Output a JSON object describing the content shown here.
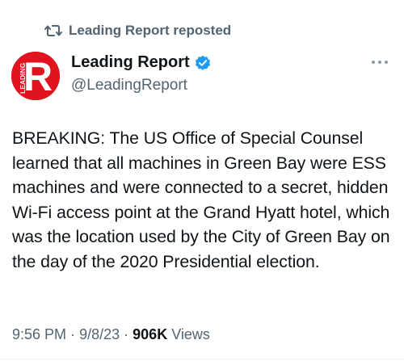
{
  "repost": {
    "icon": "repost-icon",
    "label": "Leading Report reposted"
  },
  "author": {
    "avatar_icon": "leading-report-logo",
    "avatar_letter": "R",
    "avatar_text": "LEADING",
    "name": "Leading Report",
    "verified_icon": "verified-badge-icon",
    "handle": "@LeadingReport",
    "brand_color": "#e0131f",
    "verified_color": "#1d9bf0"
  },
  "post": {
    "more_icon": "more-horizontal-icon",
    "text": "BREAKING: The US Office of Special Counsel learned that all machines in Green Bay were ESS machines and were connected to a secret, hidden Wi-Fi access point at the Grand Hyatt hotel, which was the location used by the City of Green Bay on the day of the 2020 Presidential election.",
    "time": "9:56 PM",
    "date": "9/8/23",
    "separator": "·",
    "views_count": "906K",
    "views_label": "Views"
  }
}
